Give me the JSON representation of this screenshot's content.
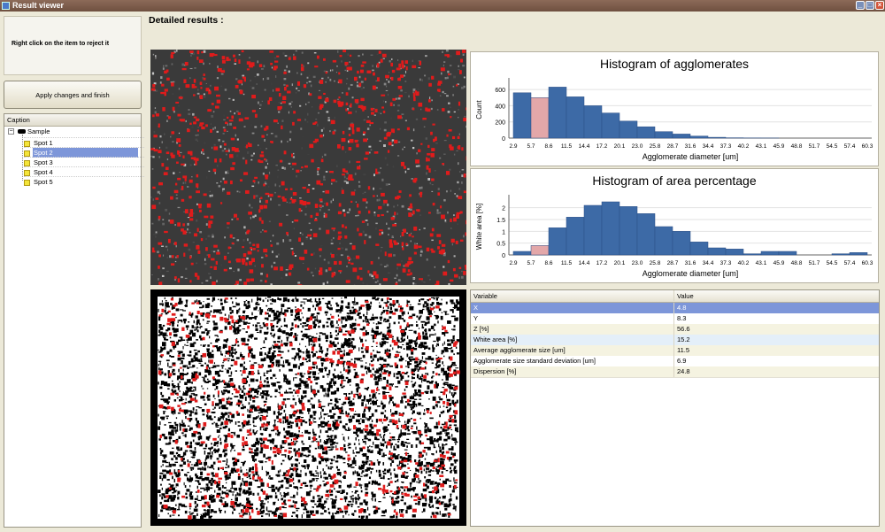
{
  "window": {
    "title": "Result viewer",
    "min": "_",
    "max": "□",
    "close": "×"
  },
  "left": {
    "info": "Right click on the item to reject it",
    "apply_button": "Apply changes and finish",
    "tree_header": "Caption",
    "toggle": "−",
    "root": "Sample",
    "spots": [
      "Spot 1",
      "Spot 2",
      "Spot 3",
      "Spot 4",
      "Spot 5"
    ],
    "selected_spot": "Spot 2"
  },
  "heading": "Detailed results :",
  "chart_data": [
    {
      "type": "bar",
      "title": "Histogram of agglomerates",
      "xlabel": "Agglomerate diameter [um]",
      "ylabel": "Count",
      "ylim": [
        0,
        700
      ],
      "yticks": [
        0,
        200,
        400,
        600
      ],
      "categories": [
        "2.9",
        "5.7",
        "8.6",
        "11.5",
        "14.4",
        "17.2",
        "20.1",
        "23.0",
        "25.8",
        "28.7",
        "31.6",
        "34.4",
        "37.3",
        "40.2",
        "43.1",
        "45.9",
        "48.8",
        "51.7",
        "54.5",
        "57.4",
        "60.3"
      ],
      "values": [
        560,
        500,
        630,
        510,
        400,
        310,
        210,
        140,
        80,
        50,
        25,
        10,
        4,
        2,
        1,
        0,
        0,
        0,
        0,
        0
      ],
      "highlight_index": 1,
      "colors": {
        "bar": "#3d6aa6",
        "highlight": "#e3a7a9"
      }
    },
    {
      "type": "bar",
      "title": "Histogram of area percentage",
      "xlabel": "Agglomerate diameter [um]",
      "ylabel": "White area [%]",
      "ylim": [
        0,
        2.4
      ],
      "yticks": [
        0,
        0.5,
        1,
        1.5,
        2
      ],
      "categories": [
        "2.9",
        "5.7",
        "8.6",
        "11.5",
        "14.4",
        "17.2",
        "20.1",
        "23.0",
        "25.8",
        "28.7",
        "31.6",
        "34.4",
        "37.3",
        "40.2",
        "43.1",
        "45.9",
        "48.8",
        "51.7",
        "54.5",
        "57.4",
        "60.3"
      ],
      "values": [
        0.15,
        0.4,
        1.15,
        1.6,
        2.1,
        2.25,
        2.05,
        1.75,
        1.2,
        1.0,
        0.55,
        0.3,
        0.25,
        0.05,
        0.15,
        0.15,
        0.0,
        0.0,
        0.05,
        0.1
      ],
      "highlight_index": 1,
      "colors": {
        "bar": "#3d6aa6",
        "highlight": "#e3a7a9"
      }
    }
  ],
  "table": {
    "headers": [
      "Variable",
      "Value"
    ],
    "rows": [
      [
        "X",
        "4.8"
      ],
      [
        "Y",
        "8.3"
      ],
      [
        "Z [%]",
        "56.6"
      ],
      [
        "White area [%]",
        "15.2"
      ],
      [
        "Average agglomerate size [um]",
        "11.5"
      ],
      [
        "Agglomerate size standard deviation [um]",
        "6.9"
      ],
      [
        "Dispersion [%]",
        "24.8"
      ]
    ]
  }
}
